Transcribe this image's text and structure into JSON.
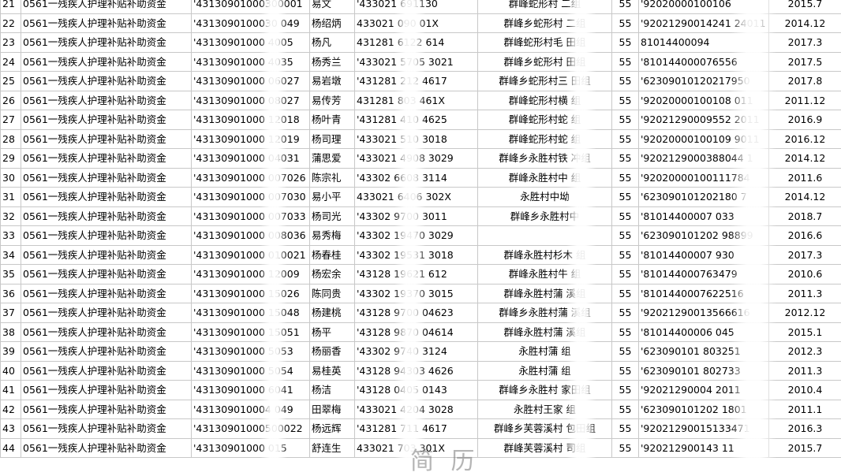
{
  "rows": [
    {
      "no": "21",
      "type": "0561一残疾人护理补贴补助资金",
      "acct": "'43130901000300001",
      "name": "易文",
      "id": "'433021 691130",
      "addr": "群峰蛇形村 二组",
      "age": "55",
      "card": "'92020000100106",
      "date": "2015.7"
    },
    {
      "no": "22",
      "type": "0561一残疾人护理补贴补助资金",
      "acct": "'4313090100030 049",
      "name": "杨绍炳",
      "id": "433021 090 01X",
      "addr": "群峰乡蛇形村 二组",
      "age": "55",
      "card": "'92021290014241 24011",
      "date": "2014.12"
    },
    {
      "no": "23",
      "type": "0561一残疾人护理补贴补助资金",
      "acct": "'43130901000 4005",
      "name": "杨凡",
      "id": "431281 6122 614",
      "addr": "群峰蛇形村毛 田组",
      "age": "55",
      "card": "81014400094",
      "date": "2017.3"
    },
    {
      "no": "24",
      "type": "0561一残疾人护理补贴补助资金",
      "acct": "'43130901000 4035",
      "name": "杨秀兰",
      "id": "'433021 5705 3021",
      "addr": "群峰乡蛇形村 田组",
      "age": "55",
      "card": "'810144000076556",
      "date": "2017.5"
    },
    {
      "no": "25",
      "type": "0561一残疾人护理补贴补助资金",
      "acct": "'43130901000 06027",
      "name": "易岩墩",
      "id": "'431281 212 4617",
      "addr": "群峰乡蛇形村三 田组",
      "age": "55",
      "card": "'62309010120217950",
      "date": "2017.8"
    },
    {
      "no": "26",
      "type": "0561一残疾人护理补贴补助资金",
      "acct": "'43130901000 08027",
      "name": "易传芳",
      "id": "431281 803 461X",
      "addr": "群峰蛇形村横 组",
      "age": "55",
      "card": "'92020000100108 011",
      "date": "2011.12"
    },
    {
      "no": "27",
      "type": "0561一残疾人护理补贴补助资金",
      "acct": "'43130901000 12018",
      "name": "杨叶青",
      "id": "'431281 410 4625",
      "addr": "群峰蛇形村蛇 组",
      "age": "55",
      "card": "'92021290009552 2011",
      "date": "2016.9"
    },
    {
      "no": "28",
      "type": "0561一残疾人护理补贴补助资金",
      "acct": "'43130901000 12019",
      "name": "杨司理",
      "id": "'433021 510 3018",
      "addr": "群峰蛇形村蛇 组",
      "age": "55",
      "card": "'92020000100109 9011",
      "date": "2016.12"
    },
    {
      "no": "29",
      "type": "0561一残疾人护理补贴补助资金",
      "acct": "'43130901000 04031",
      "name": "蒲思爱",
      "id": "'433021 4908 3029",
      "addr": "群峰乡永胜村铁 冲组",
      "age": "55",
      "card": "'9202129000388044 1",
      "date": "2014.12"
    },
    {
      "no": "30",
      "type": "0561一残疾人护理补贴补助资金",
      "acct": "'43130901000 007026",
      "name": "陈宗礼",
      "id": "'43302 6608 3114",
      "addr": "群峰永胜村中 组",
      "age": "55",
      "card": "'92020000100111784",
      "date": "2011.6"
    },
    {
      "no": "31",
      "type": "0561一残疾人护理补贴补助资金",
      "acct": "'43130901000 007030",
      "name": "易小平",
      "id": "433021 6406 302X",
      "addr": "永胜村中坳",
      "age": "55",
      "card": "'623090101202180 7",
      "date": "2014.12"
    },
    {
      "no": "32",
      "type": "0561一残疾人护理补贴补助资金",
      "acct": "'43130901000 007033",
      "name": "杨司光",
      "id": "'43302 9700 3011",
      "addr": "群峰乡永胜村中",
      "age": "55",
      "card": "'81014400007 033",
      "date": "2018.7"
    },
    {
      "no": "33",
      "type": "0561一残疾人护理补贴补助资金",
      "acct": "'43130901000 008036",
      "name": "易秀梅",
      "id": "'43302 19470 3029",
      "addr": "",
      "age": "55",
      "card": "'623090101202 98899",
      "date": "2016.6"
    },
    {
      "no": "34",
      "type": "0561一残疾人护理补贴补助资金",
      "acct": "'43130901000 010021",
      "name": "杨春桂",
      "id": "'43302 19531 3018",
      "addr": "群峰永胜村杉木 组",
      "age": "55",
      "card": "'81014400007 930",
      "date": "2017.3"
    },
    {
      "no": "35",
      "type": "0561一残疾人护理补贴补助资金",
      "acct": "'43130901000 12009",
      "name": "杨宏余",
      "id": "'43128 19621 612",
      "addr": "群峰永胜村牛 组",
      "age": "55",
      "card": "'810144000763479",
      "date": "2010.6"
    },
    {
      "no": "36",
      "type": "0561一残疾人护理补贴补助资金",
      "acct": "'43130901000 15026",
      "name": "陈同贵",
      "id": "'43302 19370 3015",
      "addr": "群峰永胜村蒲 溪组",
      "age": "55",
      "card": "'8101440007622516",
      "date": "2011.3"
    },
    {
      "no": "37",
      "type": "0561一残疾人护理补贴补助资金",
      "acct": "'43130901000 15048",
      "name": "杨建桃",
      "id": "'43128 9700 04623",
      "addr": "群峰乡永胜村蒲 溪组",
      "age": "55",
      "card": "'92021290013566616",
      "date": "2012.12"
    },
    {
      "no": "38",
      "type": "0561一残疾人护理补贴补助资金",
      "acct": "'43130901000 15051",
      "name": "杨平",
      "id": "'43128 9870 04614",
      "addr": "群峰永胜村蒲 溪组",
      "age": "55",
      "card": "'81014400006 045",
      "date": "2015.1"
    },
    {
      "no": "39",
      "type": "0561一残疾人护理补贴补助资金",
      "acct": "'43130901000 5053",
      "name": "杨丽香",
      "id": "'43302 9740 3124",
      "addr": "永胜村蒲 组",
      "age": "55",
      "card": "'623090101 803251",
      "date": "2012.3"
    },
    {
      "no": "40",
      "type": "0561一残疾人护理补贴补助资金",
      "acct": "'43130901000 5054",
      "name": "易桂英",
      "id": "'43128 94303 4626",
      "addr": "永胜村蒲 组",
      "age": "55",
      "card": "'623090101 802733",
      "date": "2011.3"
    },
    {
      "no": "41",
      "type": "0561一残疾人护理补贴补助资金",
      "acct": "'43130901000 6041",
      "name": "杨洁",
      "id": "'43128 0405 0143",
      "addr": "群峰乡永胜村 家田组",
      "age": "55",
      "card": "'92021290004 2011",
      "date": "2010.4"
    },
    {
      "no": "42",
      "type": "0561一残疾人护理补贴补助资金",
      "acct": "'431309010004 049",
      "name": "田翠梅",
      "id": "'433021 4204 3028",
      "addr": "永胜村王家 组",
      "age": "55",
      "card": "'623090101202 1801",
      "date": "2011.1"
    },
    {
      "no": "43",
      "type": "0561一残疾人护理补贴补助资金",
      "acct": "'43130901000500022",
      "name": "杨远辉",
      "id": "'431281 711 4617",
      "addr": "群峰乡芙蓉溪村 包田组",
      "age": "55",
      "card": "'92021290015133471",
      "date": "2016.3"
    },
    {
      "no": "44",
      "type": "0561一残疾人护理补贴补助资金",
      "acct": "'43130901000 015",
      "name": "舒连生",
      "id": "433021 703 301X",
      "addr": "群峰芙蓉溪村 司组",
      "age": "55",
      "card": "'920212900143 11",
      "date": "2015.7"
    }
  ],
  "watermark": "简 历"
}
